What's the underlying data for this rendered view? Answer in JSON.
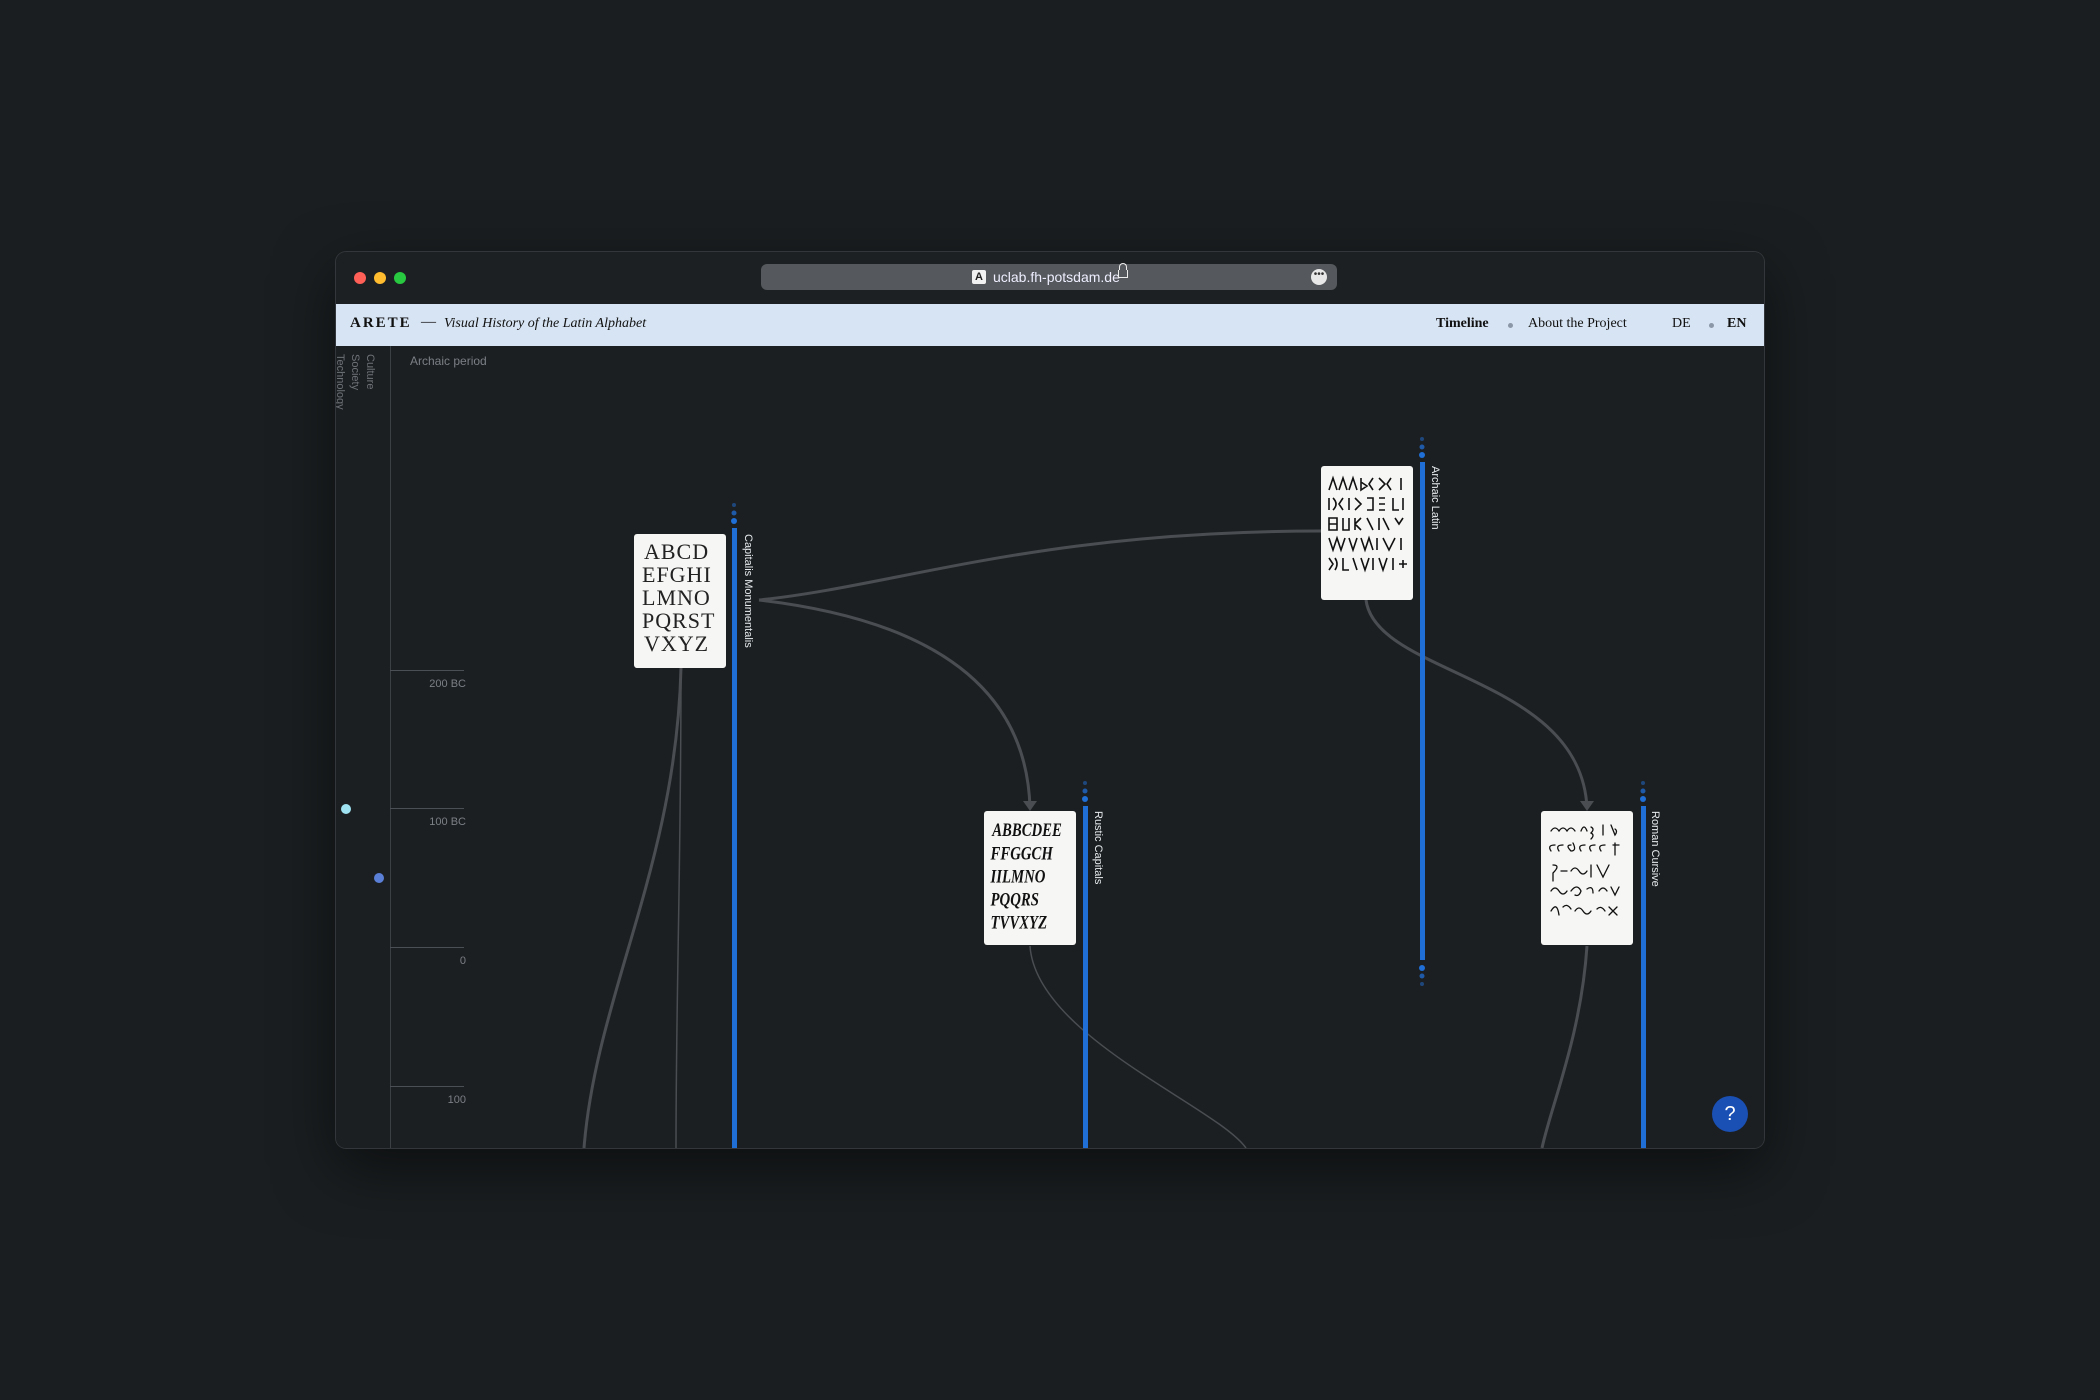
{
  "browser": {
    "url": "uclab.fh-potsdam.de",
    "favicon_letter": "A",
    "traffic_lights": {
      "close": "#fe5f57",
      "minimize": "#febc2e",
      "maximize": "#28c840"
    }
  },
  "header": {
    "logo": "ARETE",
    "separator": "—",
    "subtitle": "Visual History of the Latin Alphabet",
    "nav": {
      "timeline": "Timeline",
      "about": "About the Project"
    },
    "lang": {
      "de": "DE",
      "en": "EN"
    }
  },
  "sidebar": {
    "categories": [
      "Culture",
      "Society",
      "Technology"
    ],
    "period_label": "Archaic period",
    "ticks": [
      "200 BC",
      "100 BC",
      "0",
      "100"
    ],
    "markers": [
      {
        "name": "culture-marker",
        "color": "#9fe3f2"
      },
      {
        "name": "technology-marker",
        "color": "#5a7fd6"
      }
    ]
  },
  "scripts": [
    {
      "name": "Capitalis Monumentalis"
    },
    {
      "name": "Rustic Capitals"
    },
    {
      "name": "Archaic Latin"
    },
    {
      "name": "Roman Cursive"
    }
  ],
  "colors": {
    "background": "#1c1f22",
    "header_bg": "#d7e4f3",
    "timeline_bar": "#1f6fd6",
    "connection": "#4a4d51",
    "help_button": "#1a4fb3"
  },
  "help": {
    "label": "?"
  }
}
